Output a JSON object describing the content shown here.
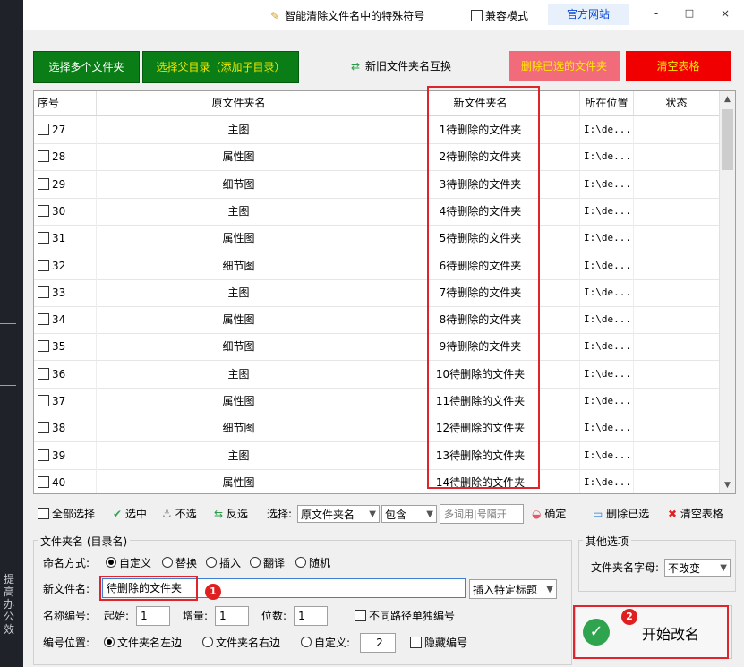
{
  "title": {
    "text": "智能清除文件名中的特殊符号",
    "compat_label": "兼容模式",
    "site_label": "官方网站",
    "min": "-",
    "max": "□",
    "close": "×"
  },
  "sidebar": {
    "text": "提高办公效"
  },
  "buttons": {
    "select_multi": "选择多个文件夹",
    "select_parent": "选择父目录（添加子目录）",
    "swap": "新旧文件夹名互换",
    "delete_selected": "删除已选的文件夹",
    "clear_table": "清空表格"
  },
  "table": {
    "headers": [
      "序号",
      "原文件夹名",
      "新文件夹名",
      "所在位置",
      "状态"
    ],
    "rows": [
      {
        "no": "27",
        "old": "主图",
        "new": "1待删除的文件夹",
        "loc": "I:\\de...",
        "status": ""
      },
      {
        "no": "28",
        "old": "属性图",
        "new": "2待删除的文件夹",
        "loc": "I:\\de...",
        "status": ""
      },
      {
        "no": "29",
        "old": "细节图",
        "new": "3待删除的文件夹",
        "loc": "I:\\de...",
        "status": ""
      },
      {
        "no": "30",
        "old": "主图",
        "new": "4待删除的文件夹",
        "loc": "I:\\de...",
        "status": ""
      },
      {
        "no": "31",
        "old": "属性图",
        "new": "5待删除的文件夹",
        "loc": "I:\\de...",
        "status": ""
      },
      {
        "no": "32",
        "old": "细节图",
        "new": "6待删除的文件夹",
        "loc": "I:\\de...",
        "status": ""
      },
      {
        "no": "33",
        "old": "主图",
        "new": "7待删除的文件夹",
        "loc": "I:\\de...",
        "status": ""
      },
      {
        "no": "34",
        "old": "属性图",
        "new": "8待删除的文件夹",
        "loc": "I:\\de...",
        "status": ""
      },
      {
        "no": "35",
        "old": "细节图",
        "new": "9待删除的文件夹",
        "loc": "I:\\de...",
        "status": ""
      },
      {
        "no": "36",
        "old": "主图",
        "new": "10待删除的文件夹",
        "loc": "I:\\de...",
        "status": ""
      },
      {
        "no": "37",
        "old": "属性图",
        "new": "11待删除的文件夹",
        "loc": "I:\\de...",
        "status": ""
      },
      {
        "no": "38",
        "old": "细节图",
        "new": "12待删除的文件夹",
        "loc": "I:\\de...",
        "status": ""
      },
      {
        "no": "39",
        "old": "主图",
        "new": "13待删除的文件夹",
        "loc": "I:\\de...",
        "status": ""
      },
      {
        "no": "40",
        "old": "属性图",
        "new": "14待删除的文件夹",
        "loc": "I:\\de...",
        "status": ""
      }
    ]
  },
  "toolbar": {
    "select_all": "全部选择",
    "check": "选中",
    "uncheck": "不选",
    "invert": "反选",
    "select_label": "选择:",
    "field_value": "原文件夹名",
    "match_value": "包含",
    "keyword_placeholder": "多词用|号隔开",
    "confirm": "确定",
    "delete_selected": "删除已选",
    "clear_table": "清空表格"
  },
  "form": {
    "group_title": "文件夹名 (目录名)",
    "naming_label": "命名方式:",
    "naming_options": [
      "自定义",
      "替换",
      "插入",
      "翻译",
      "随机"
    ],
    "new_name_label": "新文件名:",
    "new_name_value": "待删除的文件夹",
    "insert_title_label": "插入特定标题",
    "numbering_label": "名称编号:",
    "start_label": "起始:",
    "start_value": "1",
    "increment_label": "增量:",
    "increment_value": "1",
    "digits_label": "位数:",
    "digits_value": "1",
    "per_path_label": "不同路径单独编号",
    "position_label": "编号位置:",
    "position_options": [
      "文件夹名左边",
      "文件夹名右边",
      "自定义:"
    ],
    "custom_value": "2",
    "hide_number_label": "隐藏编号"
  },
  "other": {
    "group_title": "其他选项",
    "letter_case_label": "文件夹名字母:",
    "letter_case_value": "不改变"
  },
  "start": {
    "label": "开始改名",
    "icon": "check-icon"
  },
  "badges": {
    "b1": "1",
    "b2": "2"
  }
}
